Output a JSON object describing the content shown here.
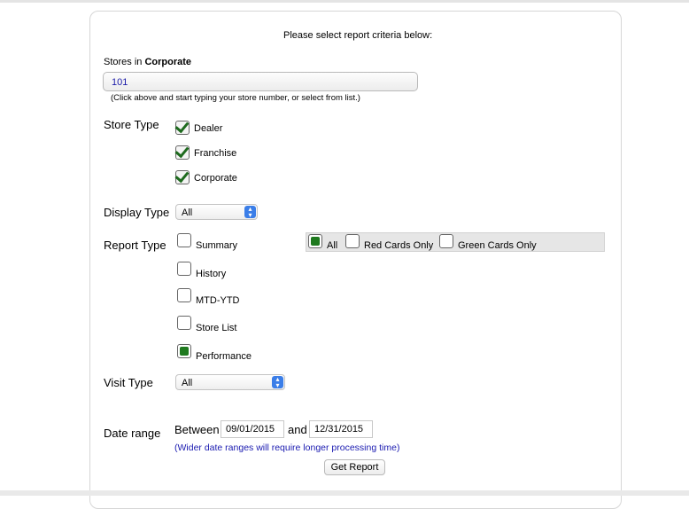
{
  "form": {
    "title": "Please select report criteria below:",
    "stores_label_prefix": "Stores in ",
    "stores_label_bold": "Corporate",
    "store_input_value": "101",
    "store_hint": "(Click above and start typing your store number, or select from list.)"
  },
  "store_type": {
    "label": "Store Type",
    "options": [
      {
        "label": "Dealer",
        "checked": true
      },
      {
        "label": "Franchise",
        "checked": true
      },
      {
        "label": "Corporate",
        "checked": true
      }
    ]
  },
  "display_type": {
    "label": "Display Type",
    "selected": "All"
  },
  "report_type": {
    "label": "Report Type",
    "options": [
      {
        "label": "Summary",
        "selected": false
      },
      {
        "label": "History",
        "selected": false
      },
      {
        "label": "MTD-YTD",
        "selected": false
      },
      {
        "label": "Store List",
        "selected": false
      },
      {
        "label": "Performance",
        "selected": true
      }
    ],
    "card_filter": [
      {
        "label": "All",
        "selected": true
      },
      {
        "label": "Red Cards Only",
        "selected": false
      },
      {
        "label": "Green Cards Only",
        "selected": false
      }
    ]
  },
  "visit_type": {
    "label": "Visit Type",
    "selected": "All"
  },
  "date_range": {
    "label": "Date range",
    "between": "Between",
    "start": "09/01/2015",
    "and": "and",
    "end": "12/31/2015",
    "note": "(Wider date ranges will require longer processing time)"
  },
  "actions": {
    "get_report": "Get Report"
  },
  "colors": {
    "accent_green": "#1f7a1f",
    "link_blue": "#1a1ab0",
    "select_arrow": "#3b7ee8"
  }
}
